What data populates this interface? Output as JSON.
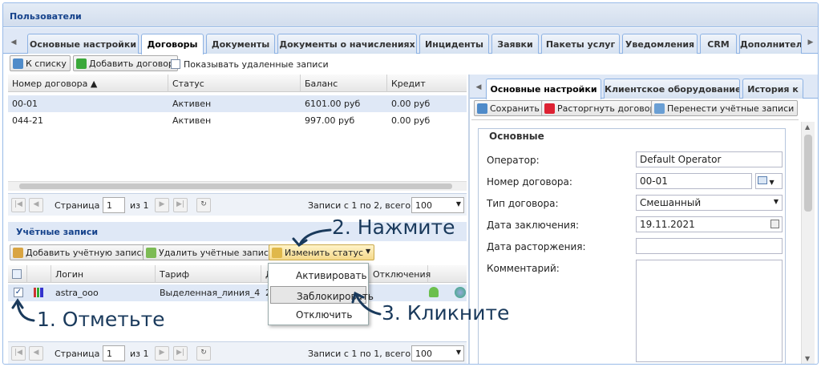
{
  "window": {
    "title": "Пользователи"
  },
  "main_tabs": [
    "Основные настройки",
    "Договоры",
    "Документы",
    "Документы о начислениях",
    "Инциденты",
    "Заявки",
    "Пакеты услуг",
    "Уведомления",
    "CRM",
    "Дополнител"
  ],
  "contracts_toolbar": {
    "back": "К списку",
    "add": "Добавить договор",
    "show_deleted": "Показывать удаленные записи"
  },
  "contracts_table": {
    "columns": [
      "Номер договора",
      "Статус",
      "Баланс",
      "Кредит"
    ],
    "rows": [
      {
        "number": "00-01",
        "status": "Активен",
        "balance": "6101.00 руб",
        "credit": "0.00 руб"
      },
      {
        "number": "044-21",
        "status": "Активен",
        "balance": "997.00 руб",
        "credit": "0.00 руб"
      }
    ]
  },
  "pager1": {
    "page_label": "Страница",
    "page": "1",
    "of": "из 1",
    "records": "Записи с 1 по 2, всего 2",
    "size": "100"
  },
  "accounts": {
    "title": "Учётные записи",
    "add": "Добавить учётную запись",
    "delete": "Удалить учётные записи",
    "change_status": "Изменить статус",
    "columns": [
      "Логин",
      "Тариф",
      "Д",
      "Отключения"
    ],
    "rows": [
      {
        "login": "astra_ooo",
        "tariff": "Выделенная_линия_4",
        "d": "2"
      }
    ]
  },
  "status_menu": [
    "Активировать",
    "Заблокировать",
    "Отключить"
  ],
  "pager2": {
    "page_label": "Страница",
    "page": "1",
    "of": "из 1",
    "records": "Записи с 1 по 1, всего 1",
    "size": "100"
  },
  "right_tabs": [
    "Основные настройки",
    "Клиентское оборудование",
    "История к"
  ],
  "right_toolbar": {
    "save": "Сохранить",
    "terminate": "Расторгнуть договор",
    "transfer": "Перенести учётные записи"
  },
  "form": {
    "section": "Основные",
    "operator_label": "Оператор:",
    "operator": "Default Operator",
    "number_label": "Номер договора:",
    "number": "00-01",
    "type_label": "Тип договора:",
    "type": "Смешанный",
    "date_label": "Дата заключения:",
    "date": "19.11.2021",
    "term_label": "Дата расторжения:",
    "term": "",
    "comment_label": "Комментарий:"
  },
  "annotations": {
    "step1": "1. Отметьте",
    "step2": "2. Нажмите",
    "step3": "3. Кликните"
  },
  "colors": {
    "accent": "#15428b",
    "annotation": "#1a3a5c",
    "tab_border": "#8db2e3"
  }
}
